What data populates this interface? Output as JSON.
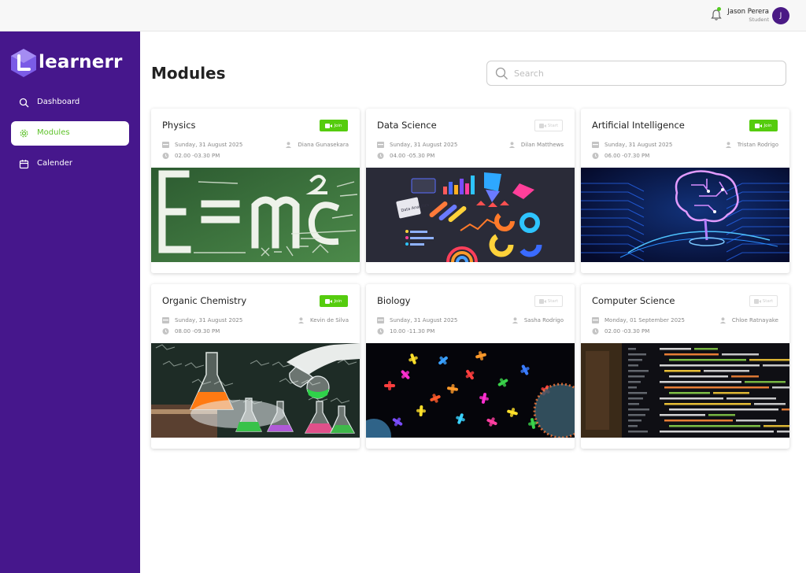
{
  "app": {
    "logo_text": "learnerr"
  },
  "topbar": {
    "user_name": "Jason Perera",
    "user_role": "Student",
    "avatar_initial": "J"
  },
  "sidebar": {
    "items": [
      {
        "label": "Dashboard",
        "icon": "search-icon",
        "active": false
      },
      {
        "label": "Modules",
        "icon": "gear-icon",
        "active": true
      },
      {
        "label": "Calender",
        "icon": "calendar-icon",
        "active": false
      }
    ]
  },
  "main": {
    "title": "Modules",
    "search": {
      "placeholder": "Search",
      "value": ""
    },
    "modules": [
      {
        "title": "Physics",
        "button": "Join",
        "date": "Sunday, 31 August 2025",
        "time": "02.00 -03.30 PM",
        "lecturer": "Diana Gunasekara",
        "image": "chalkboard-equation"
      },
      {
        "title": "Data Science",
        "button": "Start",
        "date": "Sunday, 31 August 2025",
        "time": "04.00 -05.30 PM",
        "lecturer": "Dilan Matthews",
        "image": "data-analytics",
        "image_label": "Data Analytics"
      },
      {
        "title": "Artificial Intelligence",
        "button": "Join",
        "date": "Sunday, 31 August 2025",
        "time": "06.00 -07.30 PM",
        "lecturer": "Tristan Rodrigo",
        "image": "neon-brain"
      },
      {
        "title": "Organic Chemistry",
        "button": "Join",
        "date": "Sunday, 31 August 2025",
        "time": "08.00 -09.30 PM",
        "lecturer": "Kevin de Silva",
        "image": "lab-flasks"
      },
      {
        "title": "Biology",
        "button": "Start",
        "date": "Sunday, 31 August 2025",
        "time": "10.00 -11.30 PM",
        "lecturer": "Sasha Rodrigo",
        "image": "chromosomes"
      },
      {
        "title": "Computer Science",
        "button": "Start",
        "date": "Monday, 01 September 2025",
        "time": "02.00 -03.30 PM",
        "lecturer": "Chloe Ratnayake",
        "image": "code-screen"
      }
    ]
  },
  "colors": {
    "sidebar": "#46178c",
    "accent_green": "#55cc0e",
    "active_text": "#5ec22a",
    "avatar": "#4a1a85"
  }
}
